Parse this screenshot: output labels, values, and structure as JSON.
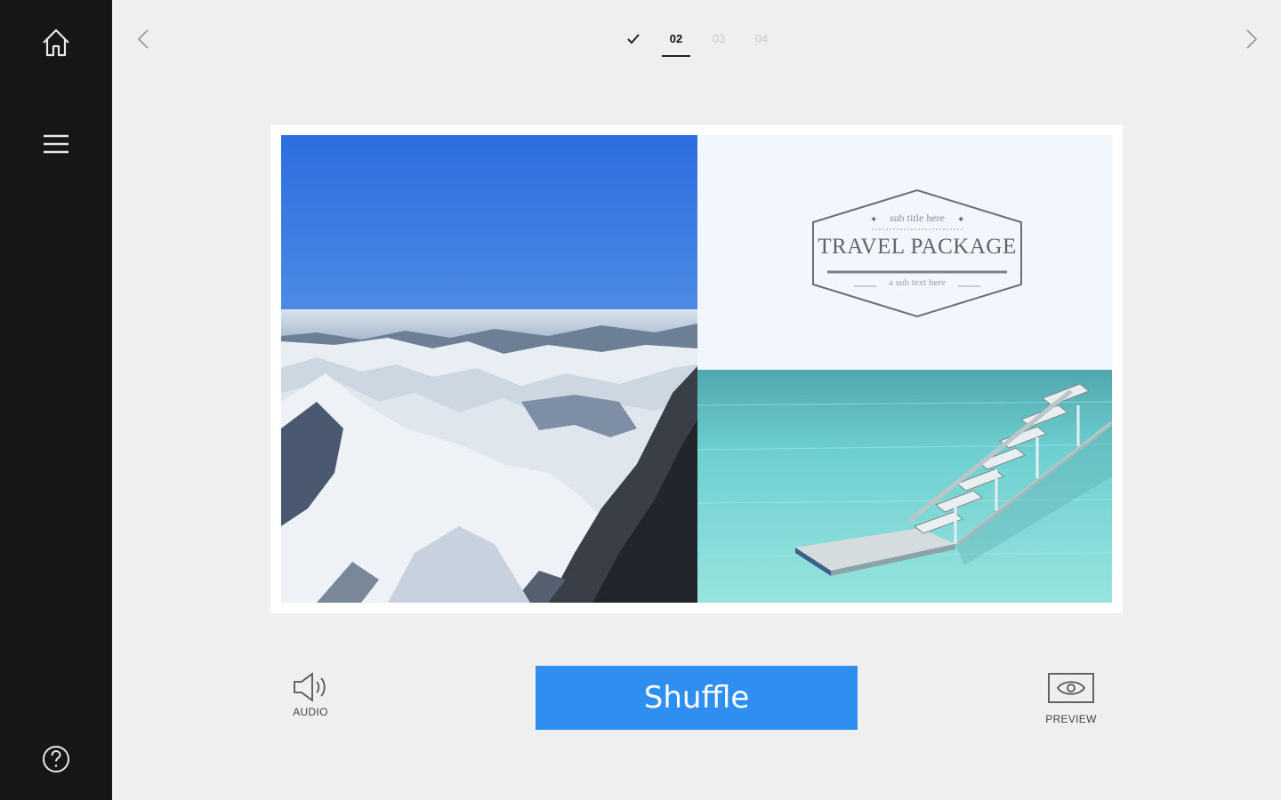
{
  "sidebar": {
    "icons": [
      "home-icon",
      "hamburger-menu-icon",
      "help-icon"
    ]
  },
  "nav": {
    "prev_icon": "chevron-left-icon",
    "next_icon": "chevron-right-icon"
  },
  "steps": [
    {
      "label": "",
      "state": "done",
      "icon": "checkmark-icon"
    },
    {
      "label": "02",
      "state": "active"
    },
    {
      "label": "03",
      "state": "inactive"
    },
    {
      "label": "04",
      "state": "inactive"
    }
  ],
  "design": {
    "badge": {
      "subtitle": "sub title here",
      "title": "TRAVEL PACKAGE",
      "subtext": "a sub text here"
    }
  },
  "toolbar": {
    "audio_label": "AUDIO",
    "shuffle_label": "Shuffle",
    "preview_label": "PREVIEW"
  },
  "colors": {
    "sidebar": "#161616",
    "background": "#efefef",
    "accent": "#2f8ff0"
  }
}
